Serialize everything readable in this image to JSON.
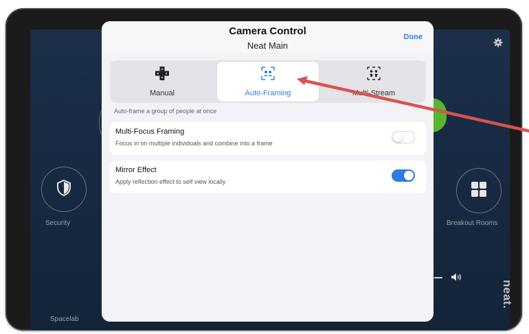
{
  "modal": {
    "title": "Camera Control",
    "subtitle": "Neat Main",
    "done_label": "Done"
  },
  "segments": [
    {
      "label": "Manual",
      "icon": "dpad-icon",
      "active": false
    },
    {
      "label": "Auto-Framing",
      "icon": "auto-framing-icon",
      "active": true
    },
    {
      "label": "Multi-Stream",
      "icon": "multi-stream-icon",
      "active": false
    }
  ],
  "hint": "Auto-frame a group of people at once",
  "settings": [
    {
      "title": "Multi-Focus Framing",
      "description": "Focus in on multiple individuals and combine into a frame",
      "enabled": false
    },
    {
      "title": "Mirror Effect",
      "description": "Apply reflection effect to self view locally",
      "enabled": true
    }
  ],
  "background": {
    "security_label": "Security",
    "breakout_label": "Breakout Rooms",
    "room_label": "Spacelab",
    "brand": "neat."
  },
  "colors": {
    "accent": "#2f7de1",
    "annotation_arrow": "#d9534f",
    "status_green": "#5cbd2f"
  }
}
